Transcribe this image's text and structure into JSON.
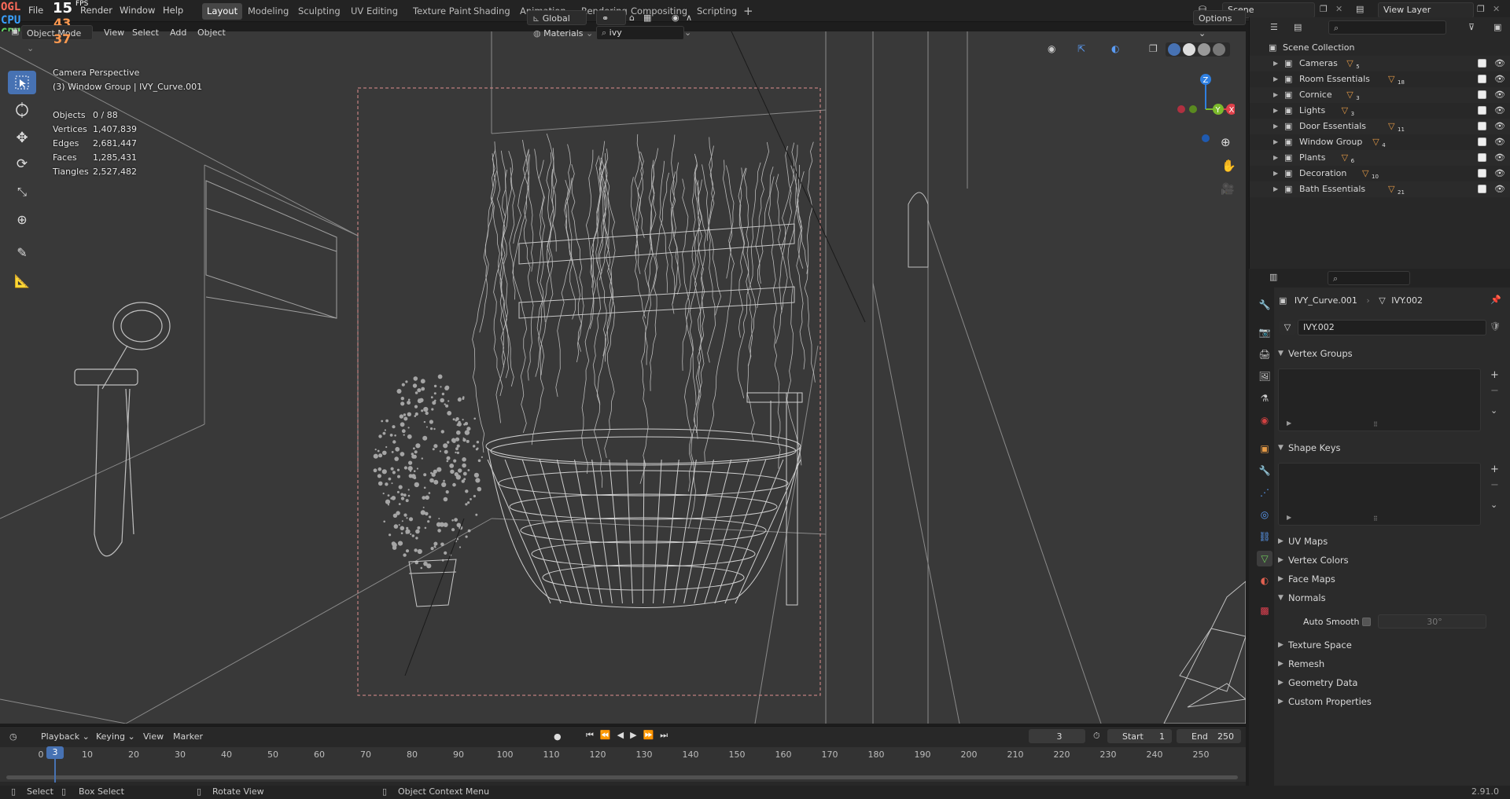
{
  "overlay_stats": {
    "ogl": "OGL",
    "cpu": "CPU",
    "gpu": "GPU",
    "fps_value": "15",
    "fps_label": "FPS",
    "cpu_value": "43",
    "gpu_value": "37"
  },
  "menu": {
    "file": "File",
    "render": "Render",
    "window": "Window",
    "help": "Help"
  },
  "workspaces": [
    "Layout",
    "Modeling",
    "Sculpting",
    "UV Editing",
    "Texture Paint",
    "Shading",
    "Animation",
    "Rendering",
    "Compositing",
    "Scripting"
  ],
  "active_workspace": "Layout",
  "scene": {
    "name": "Scene",
    "view_layer": "View Layer"
  },
  "viewport_header": {
    "mode": "Object Mode",
    "view": "View",
    "select": "Select",
    "add": "Add",
    "object": "Object",
    "transform": "Global",
    "materials": "Materials",
    "search_value": "ivy",
    "options": "Options"
  },
  "viewport_info": {
    "camera": "Camera Perspective",
    "collection": "(3) Window Group | IVY_Curve.001",
    "stats": [
      {
        "label": "Objects",
        "value": "0 / 88"
      },
      {
        "label": "Vertices",
        "value": "1,407,839"
      },
      {
        "label": "Edges",
        "value": "2,681,447"
      },
      {
        "label": "Faces",
        "value": "1,285,431"
      },
      {
        "label": "Tiangles",
        "value": "2,527,482"
      }
    ]
  },
  "outliner": {
    "root": "Scene Collection",
    "items": [
      {
        "label": "Cameras",
        "badge": "5"
      },
      {
        "label": "Room Essentials",
        "badge": "18"
      },
      {
        "label": "Cornice",
        "badge": "3"
      },
      {
        "label": "Lights",
        "badge": "3"
      },
      {
        "label": "Door Essentials",
        "badge": "11"
      },
      {
        "label": "Window Group",
        "badge": "4"
      },
      {
        "label": "Plants",
        "badge": "6"
      },
      {
        "label": "Decoration",
        "badge": "10"
      },
      {
        "label": "Bath Essentials",
        "badge": "21"
      }
    ]
  },
  "properties": {
    "object_name": "IVY_Curve.001",
    "mesh_name": "IVY.002",
    "data_field": "IVY.002",
    "panels": {
      "vertex_groups": "Vertex Groups",
      "shape_keys": "Shape Keys",
      "uv_maps": "UV Maps",
      "vertex_colors": "Vertex Colors",
      "face_maps": "Face Maps",
      "normals": "Normals",
      "texture_space": "Texture Space",
      "remesh": "Remesh",
      "geometry_data": "Geometry Data",
      "custom_properties": "Custom Properties"
    },
    "auto_smooth_label": "Auto Smooth",
    "auto_smooth_angle": "30°"
  },
  "timeline": {
    "playback": "Playback",
    "keying": "Keying",
    "view": "View",
    "marker": "Marker",
    "current_frame": "3",
    "start_label": "Start",
    "start_value": "1",
    "end_label": "End",
    "end_value": "250",
    "ticks": [
      "0",
      "10",
      "20",
      "30",
      "40",
      "50",
      "60",
      "70",
      "80",
      "90",
      "100",
      "110",
      "120",
      "130",
      "140",
      "150",
      "160",
      "170",
      "180",
      "190",
      "200",
      "210",
      "220",
      "230",
      "240",
      "250"
    ]
  },
  "statusbar": {
    "select": "Select",
    "box_select": "Box Select",
    "rotate_view": "Rotate View",
    "context_menu": "Object Context Menu",
    "version": "2.91.0"
  },
  "colors": {
    "accent": "#4772b3",
    "frame_marker": "#4772b3",
    "x_axis": "#e0404a",
    "y_axis": "#7cba2c",
    "z_axis": "#2f7fe0",
    "collection_orange": "#e59a46"
  }
}
